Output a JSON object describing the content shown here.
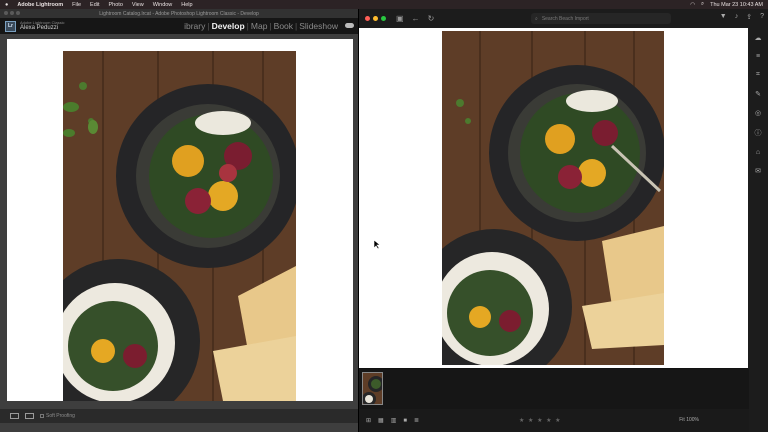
{
  "menubar": {
    "app_name": "Adobe Lightroom",
    "items": [
      "File",
      "Edit",
      "Photo",
      "View",
      "Window",
      "Help"
    ],
    "datetime": "Thu Mar 23  10:43 AM"
  },
  "classic": {
    "window_title": "Lightroom Catalog.lrcat - Adobe Photoshop Lightroom Classic - Develop",
    "identity_line1": "Adobe Lightroom Classic",
    "identity_line2": "Alexa Peduzzi",
    "modules": [
      "ibrary",
      "Develop",
      "Map",
      "Book",
      "Slideshow"
    ],
    "active_module": "Develop",
    "soft_proofing_label": "Soft Proofing"
  },
  "lightroom": {
    "search_placeholder": "Search Beach Import",
    "zoom_label": "Fit",
    "zoom_value": "100%",
    "stars": "★ ★ ★ ★ ★"
  },
  "colors": {
    "menubar_bg": "#2c2325",
    "window_bg": "#3e3e3e",
    "canvas_bg": "#ffffff",
    "wood": "#5a3a24",
    "plate": "#2e2e30"
  }
}
